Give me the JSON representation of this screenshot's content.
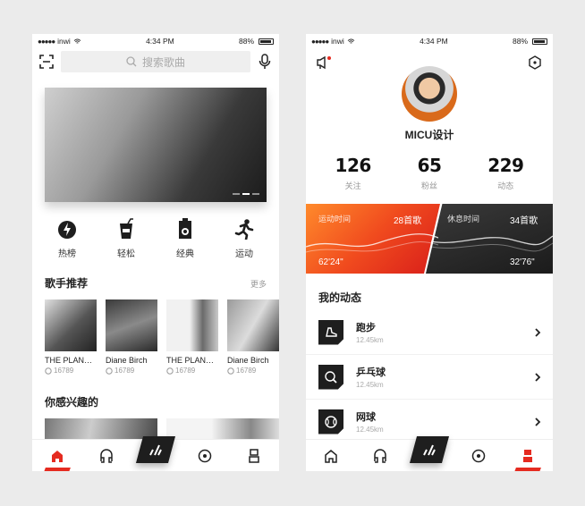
{
  "status_bar": {
    "carrier": "inwi",
    "signal": "●●●●●",
    "time": "4:34 PM",
    "battery": "88%"
  },
  "left": {
    "search_placeholder": "搜索歌曲",
    "categories": [
      {
        "label": "热榜",
        "icon": "fire-bolt-icon"
      },
      {
        "label": "轻松",
        "icon": "drink-cup-icon"
      },
      {
        "label": "经典",
        "icon": "speaker-icon"
      },
      {
        "label": "运动",
        "icon": "running-icon"
      }
    ],
    "singers_title": "歌手推荐",
    "singers_more": "更多",
    "singers": [
      {
        "name": "THE PLAN…",
        "count": "16789"
      },
      {
        "name": "Diane Birch",
        "count": "16789"
      },
      {
        "name": "THE PLAN…",
        "count": "16789"
      },
      {
        "name": "Diane Birch",
        "count": "16789"
      }
    ],
    "interest_title": "你感兴趣的"
  },
  "right": {
    "username": "MICU设计",
    "stats": [
      {
        "value": "126",
        "label": "关注"
      },
      {
        "value": "65",
        "label": "粉丝"
      },
      {
        "value": "229",
        "label": "动态"
      }
    ],
    "exercise": {
      "label": "运动时间",
      "songs": "28首歌",
      "time": "62'24\""
    },
    "rest": {
      "label": "休息时间",
      "songs": "34首歌",
      "time": "32'76\""
    },
    "activity_title": "我的动态",
    "activities": [
      {
        "title": "跑步",
        "distance": "12.45km",
        "icon": "shoe-icon"
      },
      {
        "title": "乒乓球",
        "distance": "12.45km",
        "icon": "ping-pong-icon"
      },
      {
        "title": "网球",
        "distance": "12.45km",
        "icon": "tennis-ball-icon"
      }
    ]
  },
  "colors": {
    "accent": "#e52b20",
    "dark": "#1e1e1e"
  }
}
